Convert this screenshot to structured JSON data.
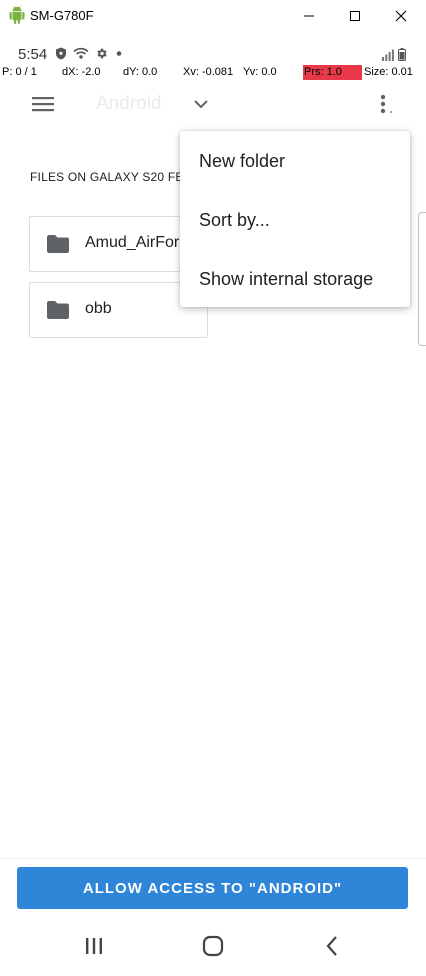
{
  "window": {
    "title": "SM-G780F",
    "icons": {
      "app": "android-icon",
      "minimize": "minimize-icon",
      "maximize": "maximize-icon",
      "close": "close-icon"
    }
  },
  "status_bar": {
    "time": "5:54",
    "icons": [
      "shield-icon",
      "wifi-icon",
      "gear-icon",
      "dot-icon"
    ],
    "right_icons": [
      "signal-icon",
      "battery-icon"
    ]
  },
  "pointer_debug": {
    "p": "P: 0 / 1",
    "dx": "dX: -2.0",
    "dy": "dY: 0.0",
    "xv": "Xv: -0.081",
    "yv": "Yv: 0.0",
    "prs": "Prs: 1.0",
    "size": "Size: 0.01",
    "prs_color": "#e8394a"
  },
  "toolbar": {
    "title": "Android",
    "menu_icon": "hamburger-menu-icon",
    "chevron_icon": "chevron-down-icon",
    "overflow_icon": "more-vert-icon"
  },
  "section_label": "FILES ON GALAXY S20 FE",
  "folders": [
    {
      "name": "Amud_AirForce",
      "icon": "folder-icon"
    },
    {
      "name": "obb",
      "icon": "folder-icon"
    }
  ],
  "popup_menu": {
    "items": [
      "New folder",
      "Sort by...",
      "Show internal storage"
    ]
  },
  "allow_button": {
    "label": "ALLOW ACCESS TO \"ANDROID\"",
    "color": "#2f86d8"
  },
  "nav_bar": {
    "icons": [
      "recents-icon",
      "home-icon",
      "back-icon"
    ]
  }
}
